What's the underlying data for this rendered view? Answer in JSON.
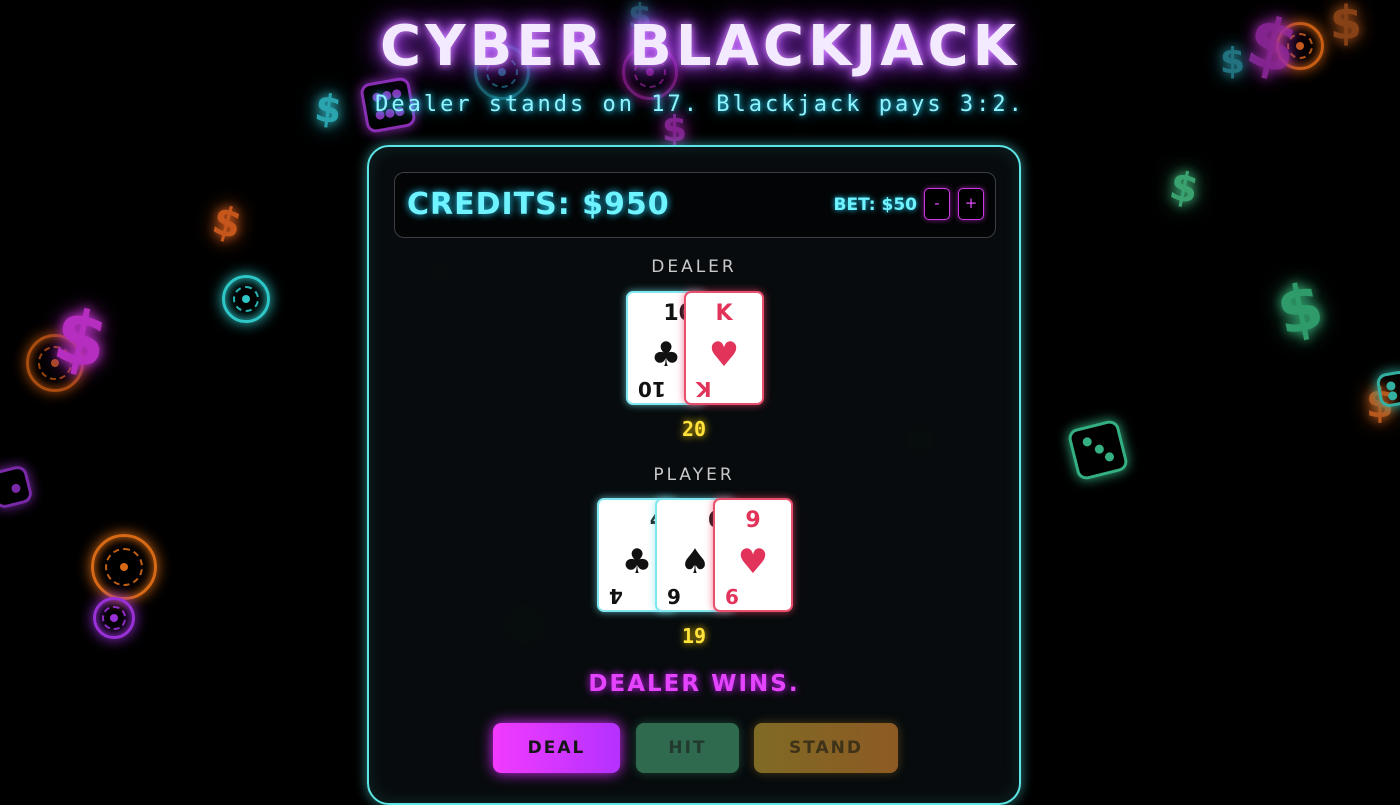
{
  "header": {
    "title": "CYBER BLACKJACK",
    "subtitle": "Dealer stands on 17. Blackjack pays 3:2."
  },
  "status": {
    "credits": "CREDITS: $950",
    "bet": "BET: $50",
    "bet_decrease_label": "-",
    "bet_increase_label": "+"
  },
  "dealer": {
    "label": "DEALER",
    "score": "20",
    "cards": [
      {
        "rank": "10",
        "suit": "♣",
        "color": "black"
      },
      {
        "rank": "K",
        "suit": "♥",
        "color": "red"
      }
    ]
  },
  "player": {
    "label": "PLAYER",
    "score": "19",
    "cards": [
      {
        "rank": "4",
        "suit": "♣",
        "color": "black"
      },
      {
        "rank": "6",
        "suit": "♠",
        "color": "black"
      },
      {
        "rank": "9",
        "suit": "♥",
        "color": "red"
      }
    ]
  },
  "result": "DEALER WINS.",
  "actions": {
    "deal": "DEAL",
    "hit": "HIT",
    "stand": "STAND"
  },
  "background_icons": {
    "dollar_symbol": "$",
    "icon_types": [
      "poker-chip-icon",
      "dollar-icon",
      "dice-icon"
    ]
  },
  "colors": {
    "accent_cyan": "#6ff3ff",
    "accent_magenta": "#e544ff",
    "score_yellow": "#ffe23a",
    "panel_border": "#5de6e6"
  }
}
